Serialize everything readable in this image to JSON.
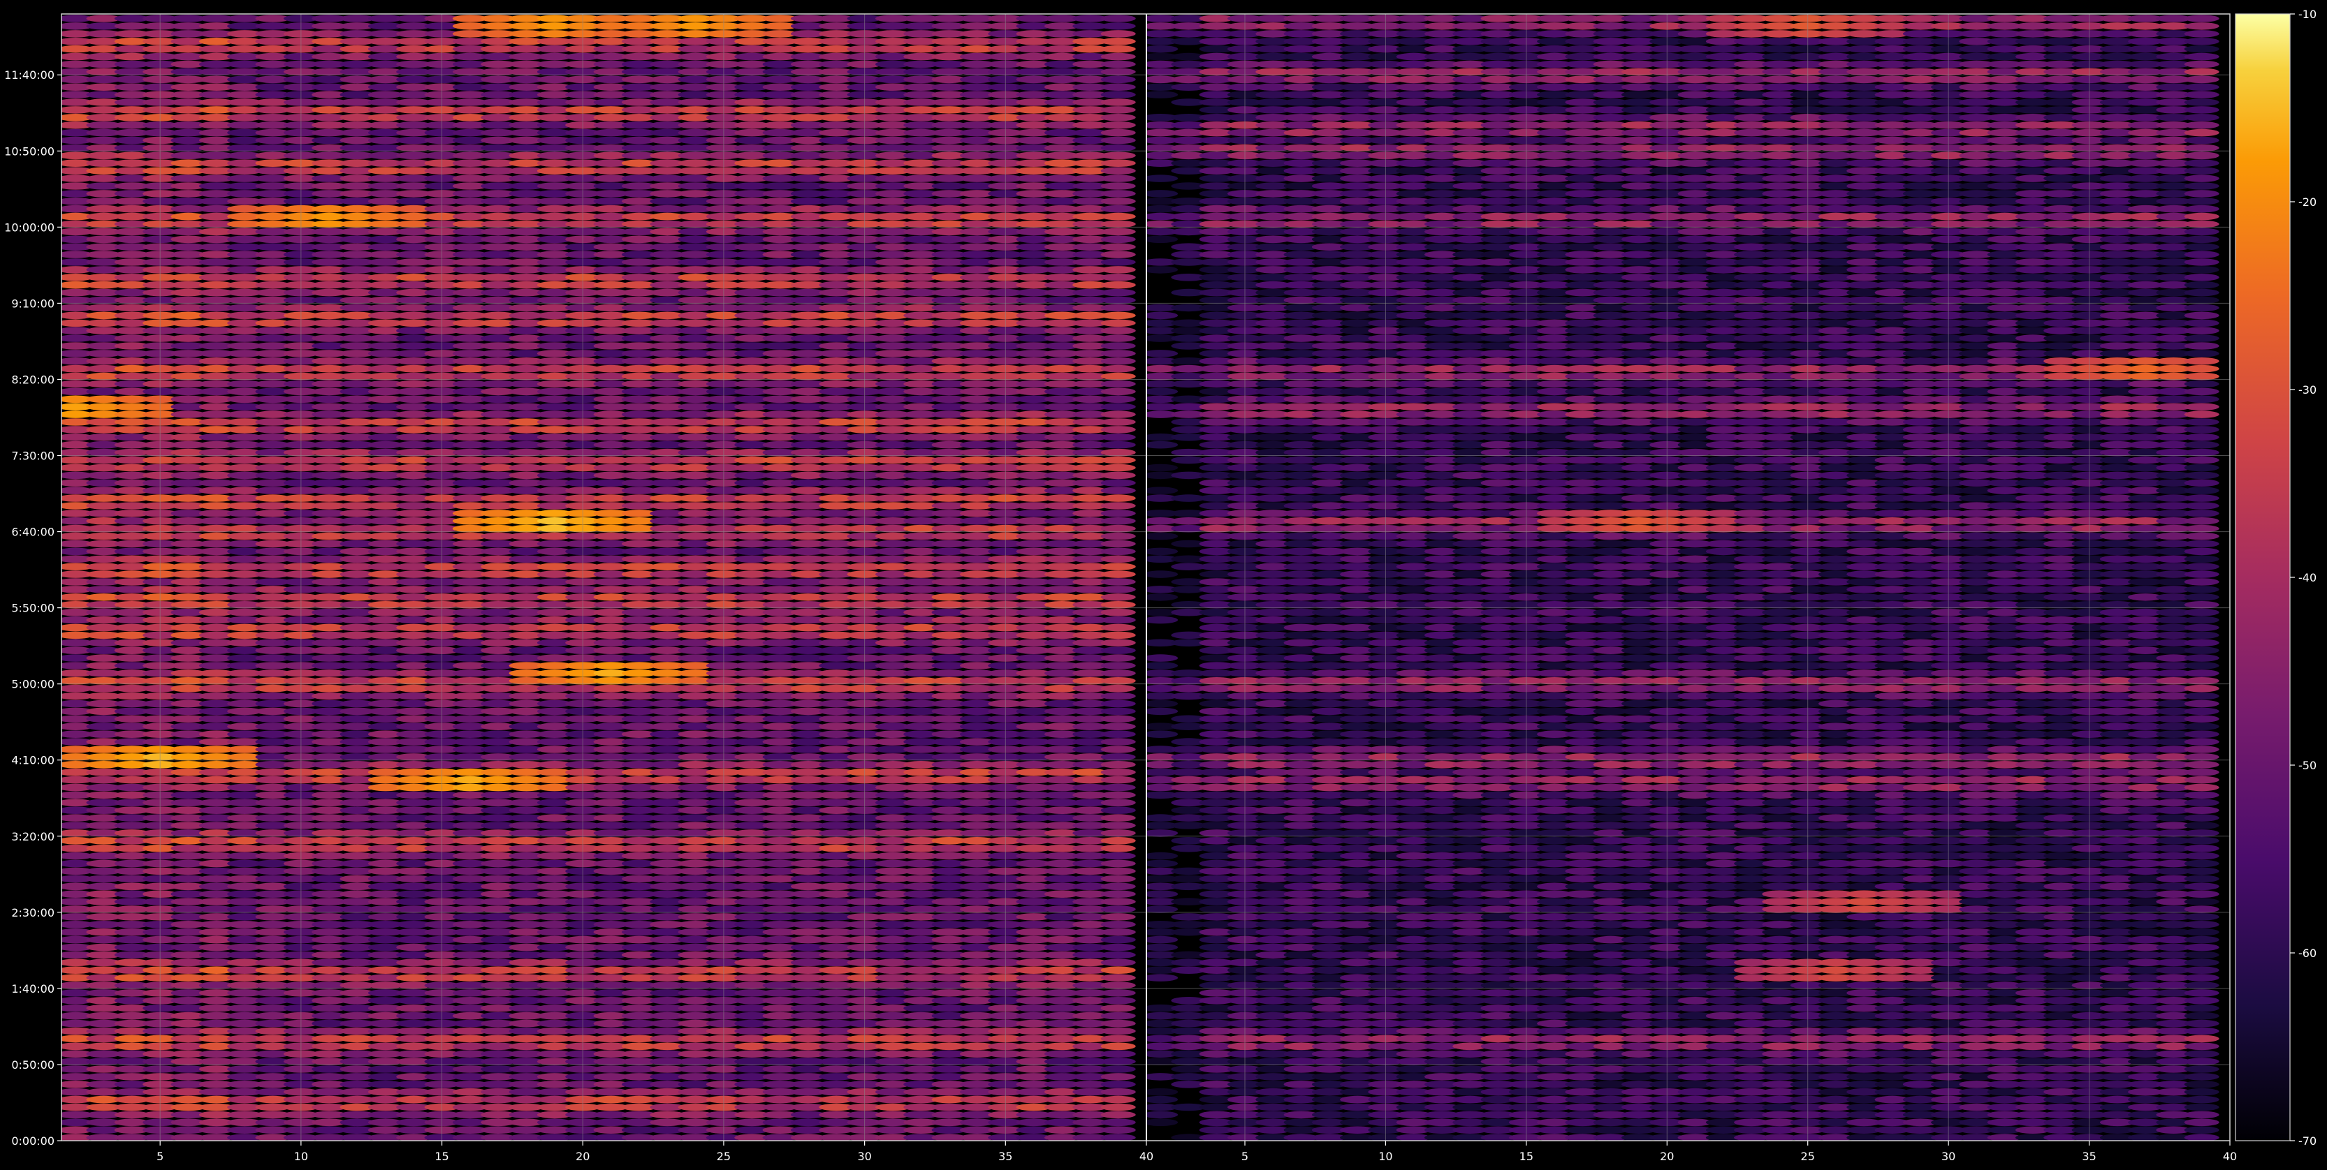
{
  "chart_data": {
    "type": "heatmap",
    "title": "",
    "xlabel": "",
    "ylabel": "",
    "colormap": "inferno",
    "background": "#000000",
    "grid": true,
    "colorbar": {
      "range": [
        -70,
        -10
      ],
      "ticks": [
        -10,
        -20,
        -30,
        -40,
        -50,
        -60,
        -70
      ]
    },
    "y_time_ticks": [
      "0:00:00",
      "0:50:00",
      "1:40:00",
      "2:30:00",
      "3:20:00",
      "4:10:00",
      "5:00:00",
      "5:50:00",
      "6:40:00",
      "7:30:00",
      "8:20:00",
      "9:10:00",
      "10:00:00",
      "10:50:00",
      "11:40:00"
    ],
    "y_range_minutes": [
      0,
      740
    ],
    "panels": [
      {
        "name": "left",
        "x_range": [
          1.5,
          40
        ],
        "x_ticks": [
          5,
          10,
          15,
          20,
          25,
          30,
          35,
          40
        ],
        "x_tick_labels": [
          "5",
          "10",
          "15",
          "20",
          "25",
          "30",
          "35",
          "40"
        ],
        "cells_x": [
          2,
          3,
          4,
          5,
          6,
          7,
          8,
          9,
          10,
          11,
          12,
          13,
          14,
          15,
          16,
          17,
          18,
          19,
          20,
          21,
          22,
          23,
          24,
          25,
          26,
          27,
          28,
          29,
          30,
          31,
          32,
          33,
          34,
          35,
          36,
          37,
          38,
          39
        ],
        "strong_rows_minutes": [
          25,
          65,
          110,
          195,
          240,
          300,
          335,
          355,
          375,
          400,
          420,
          445,
          470,
          505,
          540,
          565,
          605,
          640,
          675,
          720
        ],
        "hotspots": [
          {
            "x": 5,
            "t_min": 250,
            "value": -14
          },
          {
            "x": 19,
            "t_min": 405,
            "value": -13
          },
          {
            "x": 16,
            "t_min": 235,
            "value": -15
          },
          {
            "x": 21,
            "t_min": 307,
            "value": -16
          },
          {
            "x": 24,
            "t_min": 734,
            "value": -17
          },
          {
            "x": 19,
            "t_min": 734,
            "value": -17
          },
          {
            "x": 2,
            "t_min": 480,
            "value": -16
          },
          {
            "x": 11,
            "t_min": 605,
            "value": -17
          }
        ]
      },
      {
        "name": "right",
        "x_range": [
          1.5,
          40
        ],
        "x_ticks": [
          5,
          10,
          15,
          20,
          25,
          30,
          35,
          40
        ],
        "x_tick_labels": [
          "5",
          "10",
          "15",
          "20",
          "25",
          "30",
          "35",
          "40"
        ],
        "cells_x": [
          2,
          3,
          4,
          5,
          6,
          7,
          8,
          9,
          10,
          11,
          12,
          13,
          14,
          15,
          16,
          17,
          18,
          19,
          20,
          21,
          22,
          23,
          24,
          25,
          26,
          27,
          28,
          29,
          30,
          31,
          32,
          33,
          34,
          35,
          36,
          37,
          38,
          39
        ],
        "strong_rows_minutes": [
          65,
          235,
          250,
          300,
          405,
          480,
          505,
          605,
          650,
          665,
          700,
          734
        ],
        "hotspots": [
          {
            "x": 19,
            "t_min": 405,
            "value": -27
          },
          {
            "x": 37,
            "t_min": 505,
            "value": -24
          },
          {
            "x": 25,
            "t_min": 734,
            "value": -27
          },
          {
            "x": 27,
            "t_min": 155,
            "value": -30
          },
          {
            "x": 26,
            "t_min": 110,
            "value": -30
          }
        ]
      }
    ]
  }
}
